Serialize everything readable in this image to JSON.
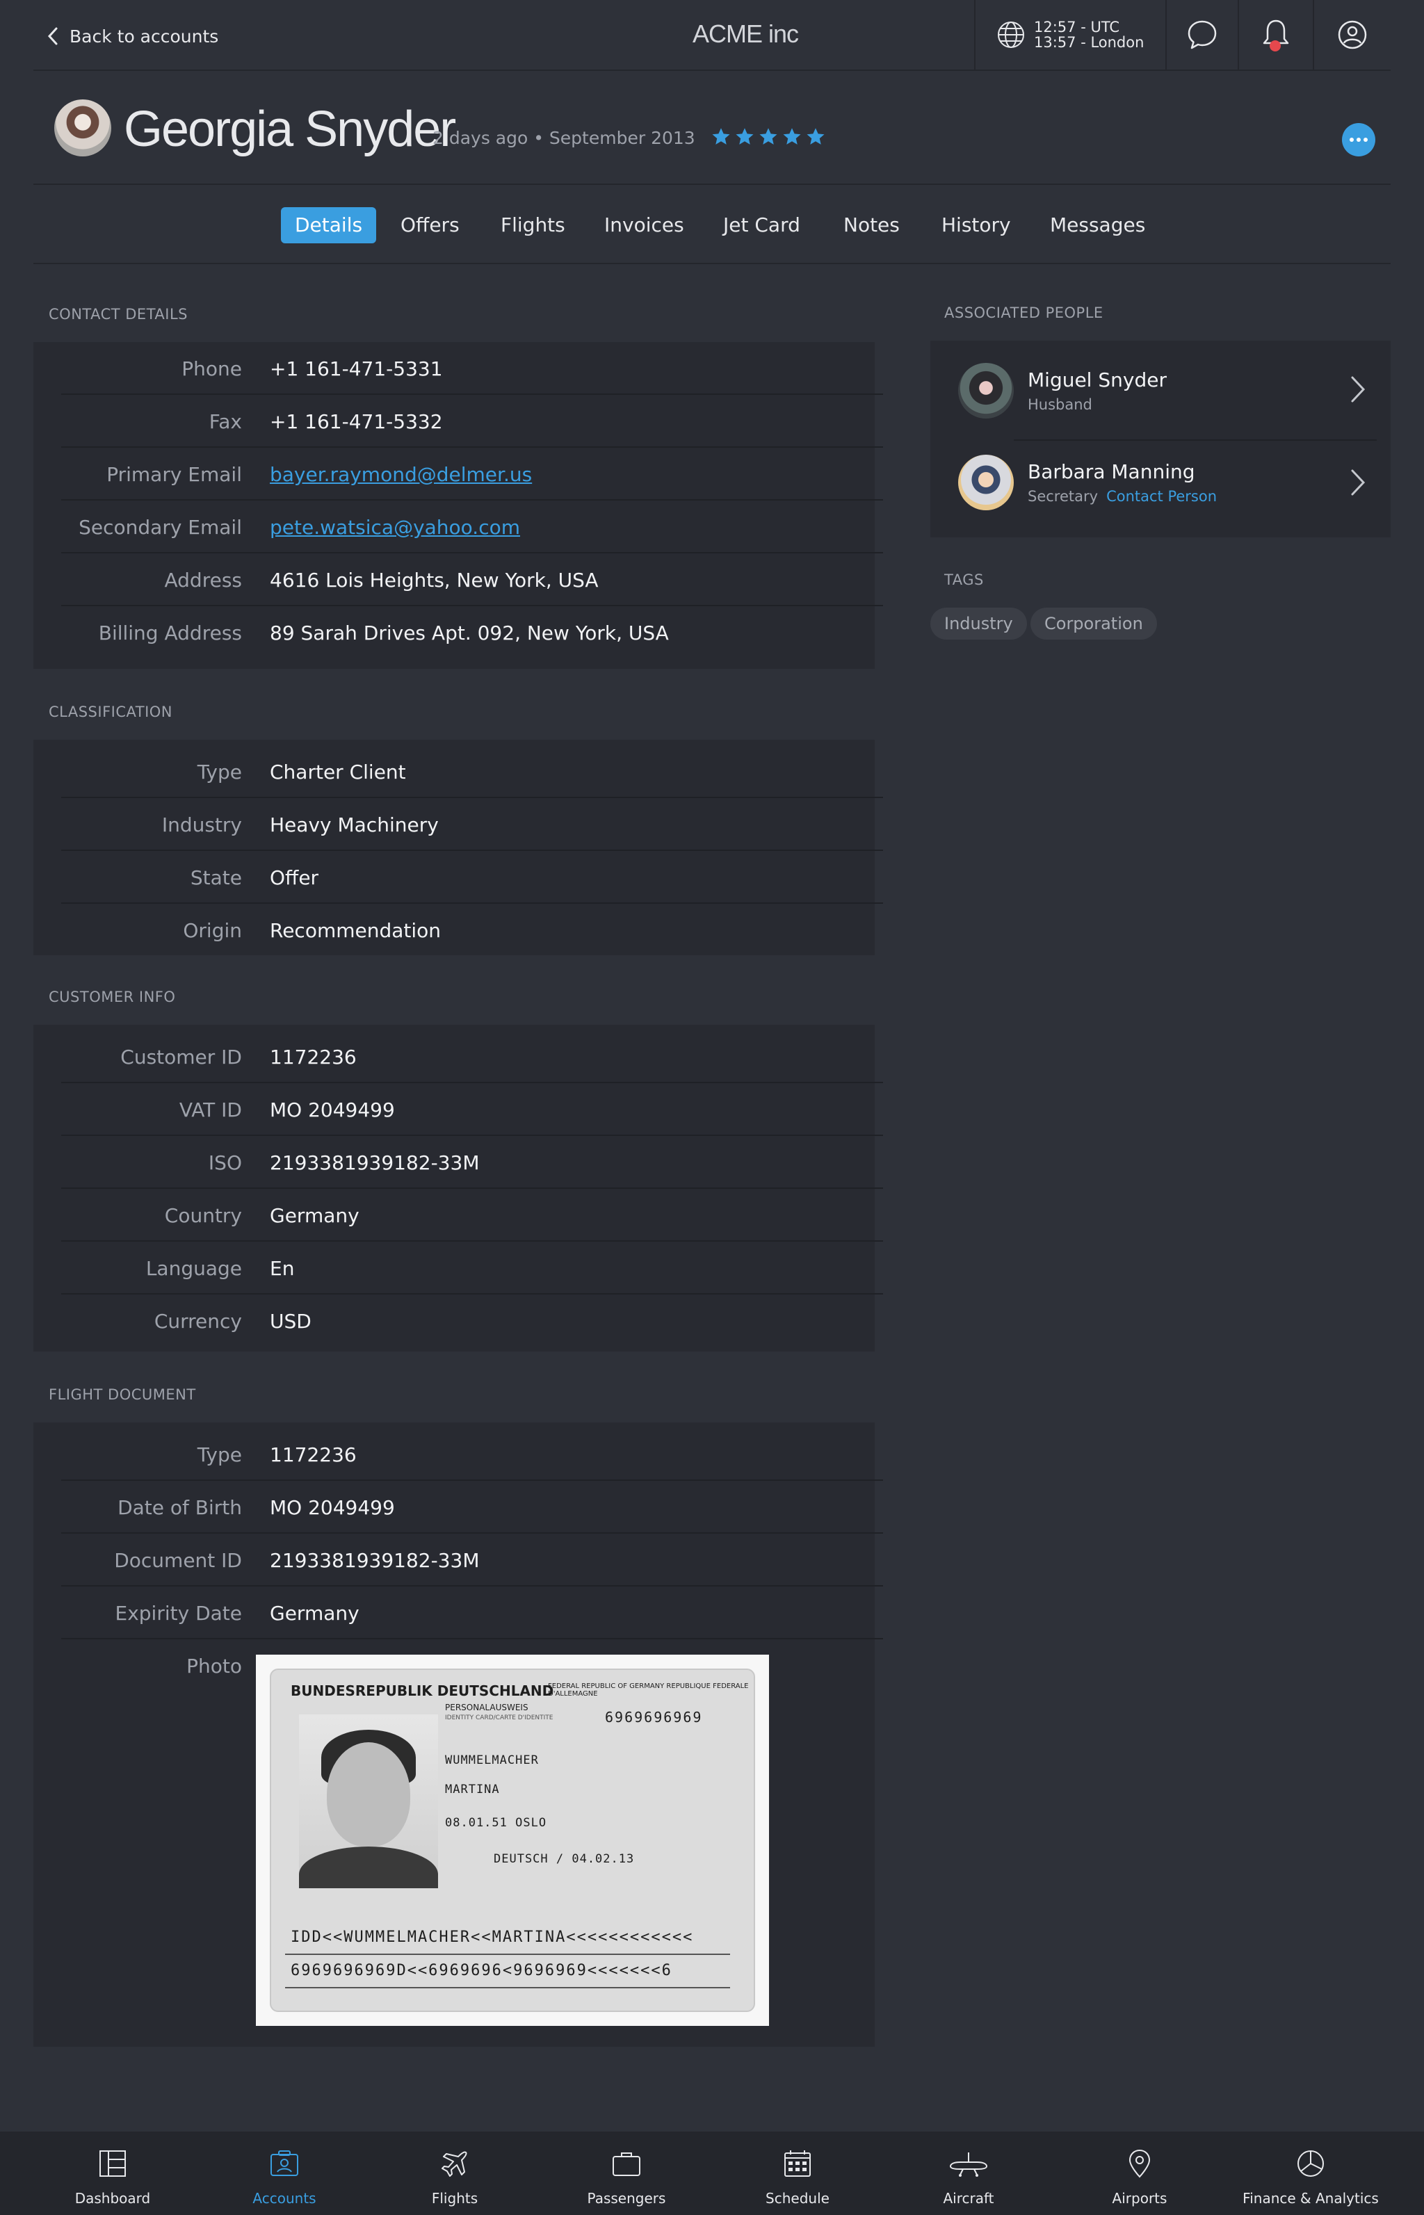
{
  "topbar": {
    "back_label": "Back to accounts",
    "app_title": "ACME inc",
    "clock_utc": "12:57 - UTC",
    "clock_local": "13:57 - London"
  },
  "profile": {
    "name": "Georgia Snyder",
    "meta": "2 days ago • September 2013",
    "rating": 5
  },
  "tabs": [
    {
      "label": "Details",
      "active": true
    },
    {
      "label": "Offers"
    },
    {
      "label": "Flights"
    },
    {
      "label": "Invoices"
    },
    {
      "label": "Jet Card"
    },
    {
      "label": "Notes"
    },
    {
      "label": "History"
    },
    {
      "label": "Messages"
    }
  ],
  "contact": {
    "title": "CONTACT DETAILS",
    "rows": [
      {
        "label": "Phone",
        "value": "+1 161-471-5331"
      },
      {
        "label": "Fax",
        "value": "+1 161-471-5332"
      },
      {
        "label": "Primary Email",
        "value": "bayer.raymond@delmer.us"
      },
      {
        "label": "Secondary Email",
        "value": "pete.watsica@yahoo.com"
      },
      {
        "label": "Address",
        "value": "4616 Lois Heights, New York, USA"
      },
      {
        "label": "Billing Address",
        "value": "89 Sarah Drives Apt. 092, New York, USA"
      }
    ]
  },
  "classification": {
    "title": "CLASSIFICATION",
    "rows": [
      {
        "label": "Type",
        "value": "Charter Client"
      },
      {
        "label": "Industry",
        "value": "Heavy Machinery"
      },
      {
        "label": "State",
        "value": "Offer"
      },
      {
        "label": "Origin",
        "value": "Recommendation"
      }
    ]
  },
  "customer": {
    "title": "CUSTOMER INFO",
    "rows": [
      {
        "label": "Customer ID",
        "value": "1172236"
      },
      {
        "label": "VAT ID",
        "value": "MO 2049499"
      },
      {
        "label": "ISO",
        "value": "2193381939182-33M"
      },
      {
        "label": "Country",
        "value": "Germany"
      },
      {
        "label": "Language",
        "value": "En"
      },
      {
        "label": "Currency",
        "value": "USD"
      }
    ]
  },
  "flight_document": {
    "title": "FLIGHT DOCUMENT",
    "rows": [
      {
        "label": "Type",
        "value": "1172236"
      },
      {
        "label": "Date of Birth",
        "value": "MO 2049499"
      },
      {
        "label": "Document ID",
        "value": "2193381939182-33M"
      },
      {
        "label": "Expirity Date",
        "value": "Germany"
      }
    ],
    "photo_label": "Photo",
    "passport": {
      "header": "BUNDESREPUBLIK DEUTSCHLAND",
      "header_right": "FEDERAL REPUBLIC OF GERMANY REPUBLIQUE FEDERALE D'ALLEMAGNE",
      "doc_type": "PERSONALAUSWEIS",
      "doc_type_sub": "IDENTITY CARD/CARTE D'IDENTITE",
      "number": "6969696969",
      "surname": "WUMMELMACHER",
      "given_name": "MARTINA",
      "birth": "08.01.51   OSLO",
      "nationality_expiry": "DEUTSCH / 04.02.13",
      "mrz1": "IDD<<WUMMELMACHER<<MARTINA<<<<<<<<<<<<",
      "mrz2": "6969696969D<<6969696<9696969<<<<<<<6"
    }
  },
  "associated": {
    "title": "ASSOCIATED PEOPLE",
    "people": [
      {
        "name": "Miguel Snyder",
        "role": "Husband",
        "badge": ""
      },
      {
        "name": "Barbara Manning",
        "role": "Secretary",
        "badge": "Contact Person"
      }
    ]
  },
  "tags": {
    "title": "TAGS",
    "items": [
      "Industry",
      "Corporation"
    ]
  },
  "bottom_nav": [
    {
      "label": "Dashboard",
      "icon": "dashboard-icon"
    },
    {
      "label": "Accounts",
      "icon": "accounts-icon",
      "active": true
    },
    {
      "label": "Flights",
      "icon": "plane-icon"
    },
    {
      "label": "Passengers",
      "icon": "briefcase-icon"
    },
    {
      "label": "Schedule",
      "icon": "calendar-icon"
    },
    {
      "label": "Aircraft",
      "icon": "aircraft-icon"
    },
    {
      "label": "Airports",
      "icon": "location-pin-icon"
    },
    {
      "label": "Finance & Analytics",
      "icon": "pie-chart-icon"
    }
  ],
  "colors": {
    "accent": "#3a9ee0",
    "background": "#2e3139",
    "card": "#282a31",
    "notification": "#e5484d"
  }
}
